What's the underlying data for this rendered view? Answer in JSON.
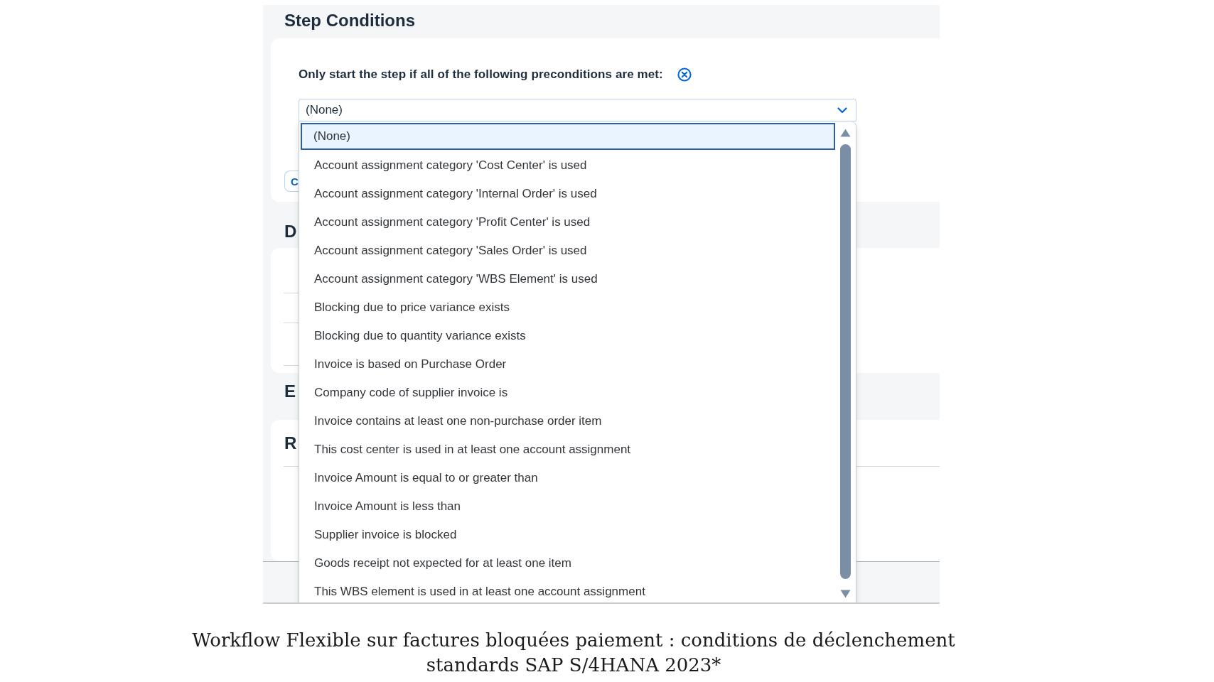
{
  "section": {
    "title": "Step Conditions"
  },
  "preconditions": {
    "label": "Only start the step if all of the following preconditions are met:",
    "select": {
      "value": "(None)",
      "expanded": true
    },
    "options": [
      {
        "label": "(None)",
        "selected": true
      },
      {
        "label": "Account assignment category 'Cost Center' is used",
        "selected": false
      },
      {
        "label": "Account assignment category 'Internal Order' is used",
        "selected": false
      },
      {
        "label": "Account assignment category 'Profit Center' is used",
        "selected": false
      },
      {
        "label": "Account assignment category 'Sales Order' is used",
        "selected": false
      },
      {
        "label": "Account assignment category 'WBS Element' is used",
        "selected": false
      },
      {
        "label": "Blocking due to price variance exists",
        "selected": false
      },
      {
        "label": "Blocking due to quantity variance exists",
        "selected": false
      },
      {
        "label": "Invoice is based on Purchase Order",
        "selected": false
      },
      {
        "label": "Company code of supplier invoice is",
        "selected": false
      },
      {
        "label": "Invoice contains at least one non-purchase order item",
        "selected": false
      },
      {
        "label": "This cost center is used in at least one account assignment",
        "selected": false
      },
      {
        "label": "Invoice Amount is equal to or greater than",
        "selected": false
      },
      {
        "label": "Invoice Amount is less than",
        "selected": false
      },
      {
        "label": "Supplier invoice is blocked",
        "selected": false
      },
      {
        "label": "Goods receipt not expected for at least one item",
        "selected": false
      },
      {
        "label": "This WBS element is used in at least one account assignment",
        "selected": false
      }
    ]
  },
  "partial_button": {
    "label": "C"
  },
  "sections": [
    {
      "title": "D"
    },
    {
      "title": "E"
    },
    {
      "title": "R"
    }
  ],
  "caption": "Workflow Flexible sur factures bloquées paiement : conditions de déclenchement standards SAP S/4HANA 2023*"
}
